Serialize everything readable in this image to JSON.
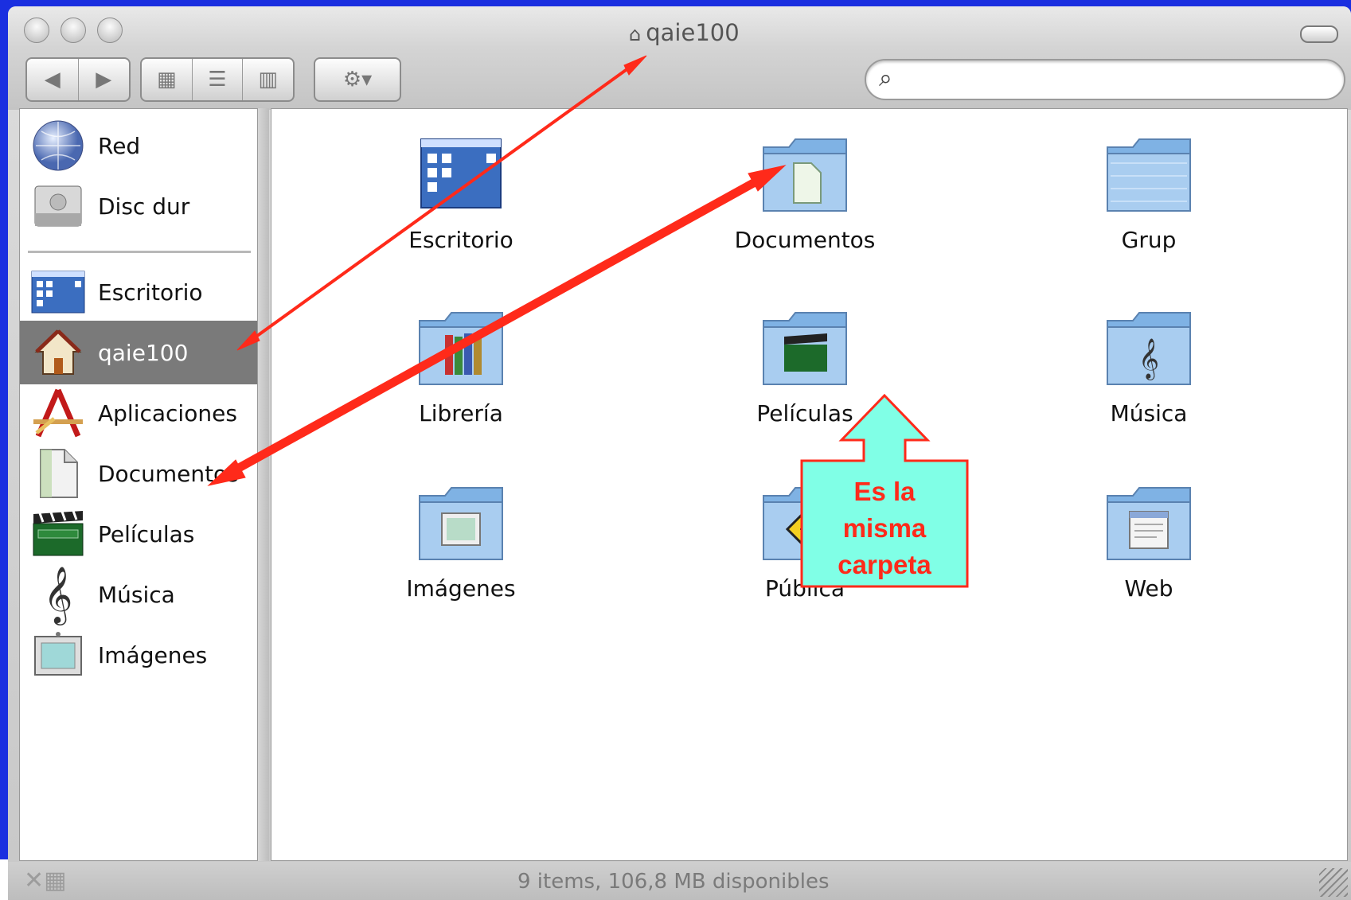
{
  "window": {
    "title": "qaie100",
    "title_icon": "home-lock-icon",
    "toolbar": {
      "back_icon": "◀",
      "forward_icon": "▶",
      "view_icon_grid": "▦",
      "view_icon_list": "☰",
      "view_icon_columns": "▥",
      "action_icon": "⚙▾",
      "search_icon": "🔍",
      "search_value": ""
    }
  },
  "sidebar": {
    "items": [
      {
        "label": "Red",
        "icon": "network-globe-icon"
      },
      {
        "label": "Disc dur",
        "icon": "hard-disk-icon"
      },
      {
        "label": "Escritorio",
        "icon": "desktop-icon"
      },
      {
        "label": "qaie100",
        "icon": "home-icon",
        "selected": true
      },
      {
        "label": "Aplicaciones",
        "icon": "applications-icon"
      },
      {
        "label": "Documentos",
        "icon": "document-icon"
      },
      {
        "label": "Películas",
        "icon": "clapperboard-icon"
      },
      {
        "label": "Música",
        "icon": "treble-clef-icon"
      },
      {
        "label": "Imágenes",
        "icon": "picture-frame-icon"
      }
    ]
  },
  "main": {
    "items": [
      {
        "label": "Escritorio",
        "icon": "desktop-icon"
      },
      {
        "label": "Documentos",
        "icon": "documents-folder-icon"
      },
      {
        "label": "Grup",
        "icon": "folder-icon"
      },
      {
        "label": "Librería",
        "icon": "library-folder-icon"
      },
      {
        "label": "Películas",
        "icon": "movies-folder-icon"
      },
      {
        "label": "Música",
        "icon": "music-folder-icon"
      },
      {
        "label": "Imágenes",
        "icon": "pictures-folder-icon"
      },
      {
        "label": "Pública",
        "icon": "public-folder-icon"
      },
      {
        "label": "Web",
        "icon": "web-folder-icon"
      }
    ]
  },
  "status": {
    "text": "9 items, 106,8 MB disponibles"
  },
  "annotation": {
    "callout_lines": [
      "Es la",
      "misma",
      "carpeta"
    ],
    "callout_fill": "#80ffe6",
    "callout_stroke": "#ff2a1a",
    "arrow_color": "#ff2a1a"
  },
  "colors": {
    "background": "#1a2fe0",
    "selection": "#7a7a7a",
    "folder_blue": "#8fbde8"
  }
}
